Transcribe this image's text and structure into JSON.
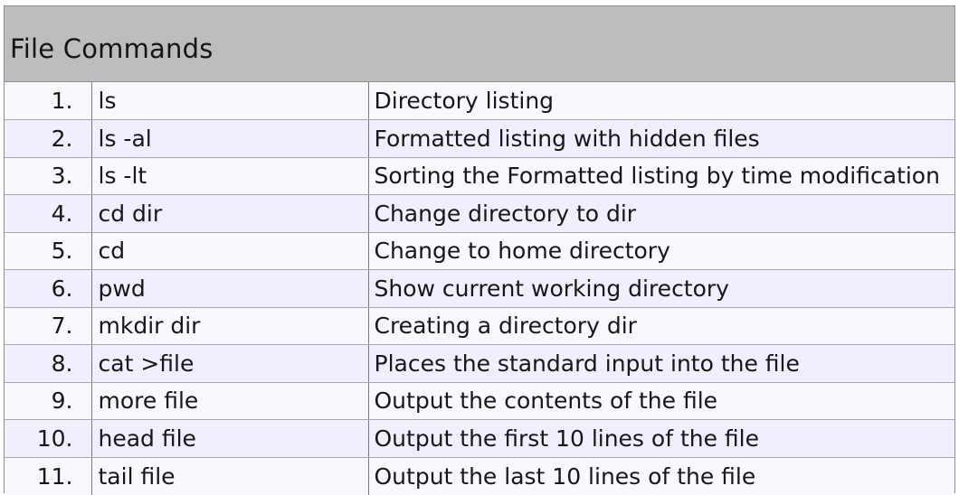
{
  "header": {
    "title": "File Commands"
  },
  "rows": [
    {
      "number": "1.",
      "command": "ls",
      "description": "Directory listing"
    },
    {
      "number": "2.",
      "command": "ls -al",
      "description": "Formatted listing with hidden files"
    },
    {
      "number": "3.",
      "command": "ls  -lt",
      "description": "Sorting the Formatted listing by time modification"
    },
    {
      "number": "4.",
      "command": "cd dir",
      "description": "Change directory to dir"
    },
    {
      "number": "5.",
      "command": "cd",
      "description": "Change to home directory"
    },
    {
      "number": "6.",
      "command": "pwd",
      "description": "Show current working directory"
    },
    {
      "number": "7.",
      "command": "mkdir dir",
      "description": "Creating a directory dir"
    },
    {
      "number": "8.",
      "command": "cat >file",
      "description": "Places the standard input into the file"
    },
    {
      "number": "9.",
      "command": "more file",
      "description": "Output the contents of the file"
    },
    {
      "number": "10.",
      "command": "head file",
      "description": "Output the first 10 lines of the file"
    },
    {
      "number": "11.",
      "command": "tail file",
      "description": "Output the last 10 lines of the file"
    }
  ]
}
